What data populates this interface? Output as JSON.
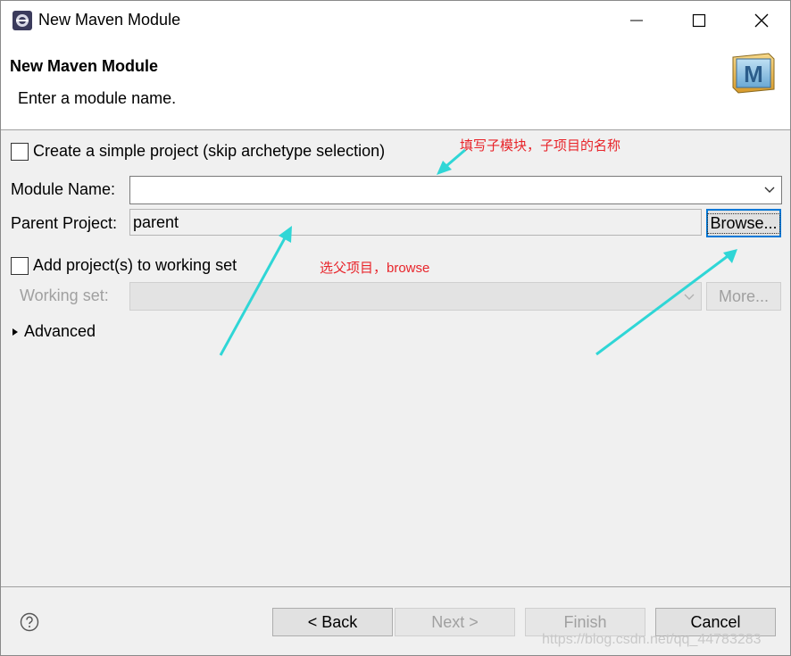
{
  "window": {
    "title": "New Maven Module"
  },
  "header": {
    "title": "New Maven Module",
    "description": "Enter a module name.",
    "logo_letter": "M"
  },
  "form": {
    "simple_project_label": "Create a simple project (skip archetype selection)",
    "simple_project_checked": false,
    "module_name_label": "Module Name:",
    "module_name_value": "",
    "parent_project_label": "Parent Project:",
    "parent_project_value": "parent",
    "browse_label": "Browse...",
    "working_set_checkbox_label": "Add project(s) to working set",
    "working_set_checked": false,
    "working_set_label": "Working set:",
    "more_label": "More...",
    "advanced_label": "Advanced"
  },
  "annotations": {
    "module_name_note": "填写子模块，子项目的名称",
    "browse_note": "选父项目，browse"
  },
  "footer": {
    "back_label": "< Back",
    "next_label": "Next >",
    "finish_label": "Finish",
    "cancel_label": "Cancel"
  },
  "watermark": "https://blog.csdn.net/qq_44783283",
  "colors": {
    "annotation_text": "#e8252b",
    "arrow": "#2fd6d6",
    "focus_border": "#0078d7"
  }
}
